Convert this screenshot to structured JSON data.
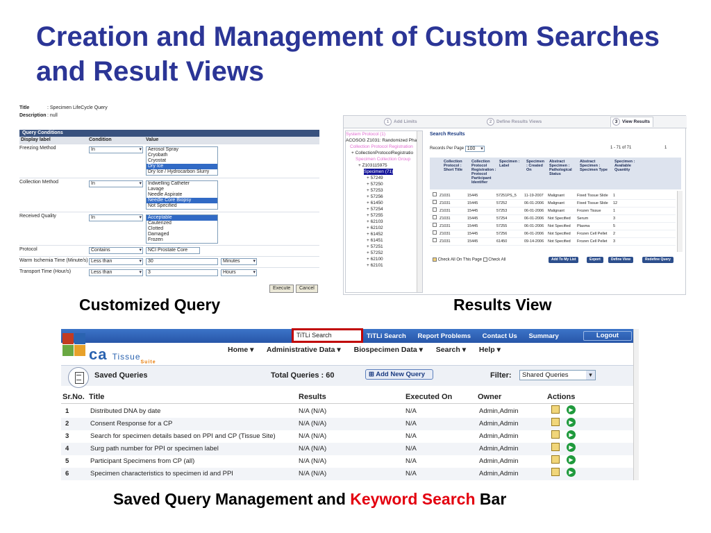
{
  "slide": {
    "title": "Creation and Management of Custom Searches and Result Views",
    "caption_query": "Customized Query",
    "caption_results": "Results View",
    "caption_bottom_pre": "Saved Query Management and ",
    "caption_bottom_kw": "Keyword Search",
    "caption_bottom_post": " Bar",
    "accent": "#2b3596",
    "highlight": "#e3000f"
  },
  "query": {
    "title_label": "Title",
    "title_value": ": Specimen LifeCycle Query",
    "desc_label": "Description",
    "desc_value": ": null",
    "conditions_header": "Query Conditions",
    "col_label": "Display label",
    "col_condition": "Condition",
    "col_value": "Value",
    "rows": [
      {
        "label": "Freezing Method",
        "cond": "In",
        "opts": [
          "Aerosol Spray",
          "Cryobath",
          "Cryostat",
          "Dry Ice",
          "Dry Ice / Hydrocarbon Slurry"
        ],
        "sel": 3
      },
      {
        "label": "Collection Method",
        "cond": "In",
        "opts": [
          "Indwelling Catheter",
          "Lavage",
          "Needle Aspirate",
          "Needle Core Biopsy",
          "Not Specified"
        ],
        "sel": 3
      },
      {
        "label": "Received Quality",
        "cond": "In",
        "opts": [
          "Acceptable",
          "Cauterized",
          "Clotted",
          "Damaged",
          "Frozen"
        ],
        "sel": 0
      }
    ],
    "protocol": {
      "label": "Protocol",
      "cond": "Contains",
      "value": "NCI Prostate Core"
    },
    "warm": {
      "label": "Warm Ischemia Time (Minute/s)",
      "cond": "Less than",
      "value": "30",
      "unit": "Minutes"
    },
    "transport": {
      "label": "Transport Time (Hour/s)",
      "cond": "Less than",
      "value": "3",
      "unit": "Hours"
    },
    "execute": "Execute",
    "cancel": "Cancel"
  },
  "results": {
    "steps": [
      "Add Limits",
      "Define Results Views",
      "View Results"
    ],
    "step_nums": [
      "1",
      "2",
      "3"
    ],
    "tree": [
      "System Protocol (1)",
      "ACOSOG Z1031: Randomized Pha",
      "Collection Protocol Registration",
      "+ CollectionProtocolRegistratio",
      "Specimen Collection Group",
      "+ Z103115975",
      "Specimen (71)",
      "+ 57249",
      "+ 57250",
      "+ 57253",
      "+ 57256",
      "+ 61450",
      "+ 57254",
      "+ 57255",
      "+ 62103",
      "+ 62102",
      "+ 61452",
      "+ 61451",
      "+ 57251",
      "+ 57252",
      "+ 62100",
      "+ 62101"
    ],
    "search_results": "Search Results",
    "records_label": "Records Per Page",
    "records_value": "100",
    "range": "1 - 71 of 71",
    "page": "1",
    "headers": [
      "Collection Protocol : Short Title",
      "Collection Protocol Registration : Protocol Participant Identifier",
      "Specimen : Label",
      "Specimen : Created On",
      "Abstract Specimen : Pathological Status",
      "Abstract Specimen : Specimen Type",
      "Specimen : Available Quantity"
    ],
    "rows": [
      [
        "Z1031",
        "15445",
        "57251PS_5",
        "11-19-2007",
        "Malignant",
        "Fixed Tissue Slide",
        "1"
      ],
      [
        "Z1031",
        "15445",
        "57252",
        "06-01-2006",
        "Malignant",
        "Fixed Tissue Slide",
        "12"
      ],
      [
        "Z1031",
        "15445",
        "57253",
        "06-01-2006",
        "Malignant",
        "Frozen Tissue",
        "1"
      ],
      [
        "Z1031",
        "15445",
        "57254",
        "06-01-2006",
        "Not Specified",
        "Serum",
        "3"
      ],
      [
        "Z1031",
        "15445",
        "57255",
        "06-01-2006",
        "Not Specified",
        "Plasma",
        "5"
      ],
      [
        "Z1031",
        "15445",
        "57256",
        "06-01-2006",
        "Not Specified",
        "Frozen Cell Pellet",
        "2"
      ],
      [
        "Z1031",
        "15445",
        "61450",
        "09-14-2006",
        "Not Specified",
        "Frozen Cell Pellet",
        "3"
      ]
    ],
    "check_page": "Check All On This Page",
    "check_all": "Check All",
    "btn_list": "Add To My List",
    "btn_export": "Export",
    "btn_view": "Define View",
    "btn_redefine": "Redefine Query"
  },
  "saved": {
    "keyword_value": "TiTLi Search",
    "top_links": [
      "TiTLi Search",
      "Report Problems",
      "Contact Us",
      "Summary"
    ],
    "logout": "Logout",
    "brand": "ca",
    "brand_tissue": "Tissue",
    "brand_suite": "Suite",
    "nav": [
      "Home ▾",
      "Administrative Data ▾",
      "Biospecimen Data ▾",
      "Search ▾",
      "Help ▾"
    ],
    "title": "Saved Queries",
    "total": "Total Queries : 60",
    "add": "Add New Query",
    "filter_label": "Filter:",
    "filter_value": "Shared Queries",
    "cols": [
      "Sr.No.",
      "Title",
      "Results",
      "Executed On",
      "Owner",
      "Actions"
    ],
    "rows": [
      [
        "1",
        "Distributed DNA by date",
        "N/A (N/A)",
        "N/A",
        "Admin,Admin"
      ],
      [
        "2",
        "Consent Response for a CP",
        "N/A (N/A)",
        "N/A",
        "Admin,Admin"
      ],
      [
        "3",
        "Search for specimen details based on PPI and CP (Tissue Site)",
        "N/A (N/A)",
        "N/A",
        "Admin,Admin"
      ],
      [
        "4",
        "Surg path number for PPI or specimen label",
        "N/A (N/A)",
        "N/A",
        "Admin,Admin"
      ],
      [
        "5",
        "Participant Specimens from CP (all)",
        "N/A (N/A)",
        "N/A",
        "Admin,Admin"
      ],
      [
        "6",
        "Specimen characteristics to specimen id and PPI",
        "N/A (N/A)",
        "N/A",
        "Admin,Admin"
      ]
    ]
  }
}
